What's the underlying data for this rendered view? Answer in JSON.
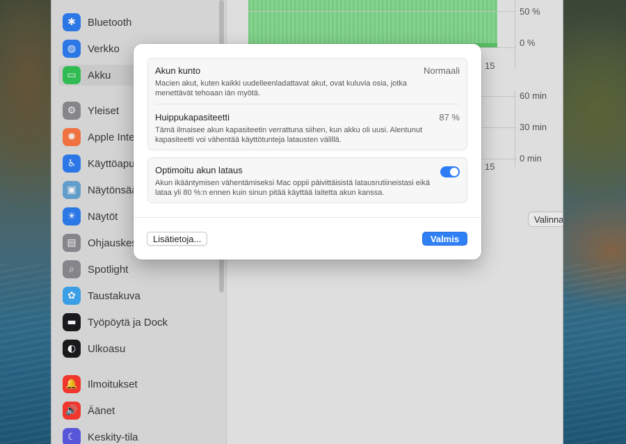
{
  "sidebar": {
    "items": [
      {
        "label": "Bluetooth",
        "icon": "bluetooth-icon",
        "glyph": "✱",
        "color": "#2f7ff5"
      },
      {
        "label": "Verkko",
        "icon": "globe-icon",
        "glyph": "◍",
        "color": "#2f7ff5"
      },
      {
        "label": "Akku",
        "icon": "battery-icon",
        "glyph": "▭",
        "color": "#34c759"
      },
      {
        "label": "Yleiset",
        "icon": "gear-icon",
        "glyph": "⚙",
        "color": "#8e8e93"
      },
      {
        "label": "Apple Inte",
        "icon": "apple-intelligence-icon",
        "glyph": "✺",
        "color": "#ff7a45"
      },
      {
        "label": "Käyttöapu",
        "icon": "accessibility-icon",
        "glyph": "♿",
        "color": "#2f7ff5"
      },
      {
        "label": "Näytönsää",
        "icon": "screensaver-icon",
        "glyph": "▣",
        "color": "#6aa8d8"
      },
      {
        "label": "Näytöt",
        "icon": "displays-icon",
        "glyph": "☀",
        "color": "#2f7ff5"
      },
      {
        "label": "Ohjauskes",
        "icon": "control-center-icon",
        "glyph": "▤",
        "color": "#8e8e93"
      },
      {
        "label": "Spotlight",
        "icon": "spotlight-icon",
        "glyph": "⌕",
        "color": "#8e8e93"
      },
      {
        "label": "Taustakuva",
        "icon": "wallpaper-icon",
        "glyph": "✿",
        "color": "#3fa9f5"
      },
      {
        "label": "Työpöytä ja Dock",
        "icon": "dock-icon",
        "glyph": "▬",
        "color": "#1c1c1e"
      },
      {
        "label": "Ulkoasu",
        "icon": "appearance-icon",
        "glyph": "◐",
        "color": "#1c1c1e"
      },
      {
        "label": "Ilmoitukset",
        "icon": "notifications-icon",
        "glyph": "🔔",
        "color": "#ff3b30"
      },
      {
        "label": "Äänet",
        "icon": "sound-icon",
        "glyph": "🔊",
        "color": "#ff3b30"
      },
      {
        "label": "Keskity-tila",
        "icon": "focus-icon",
        "glyph": "☾",
        "color": "#5e5ce6"
      }
    ]
  },
  "main": {
    "chart_top": {
      "y_labels": [
        "50 %",
        "0 %"
      ],
      "x_label": "15"
    },
    "chart_bottom": {
      "y_labels": [
        "60 min",
        "30 min",
        "0 min"
      ],
      "x_label": "15"
    },
    "options_button": "Valinnat...",
    "help_button": "?"
  },
  "sheet": {
    "health": {
      "title": "Akun kunto",
      "value": "Normaali",
      "desc": "Macien akut, kuten kaikki uudelleenladattavat akut, ovat kuluvia osia, jotka menettävät tehoaan iän myötä."
    },
    "capacity": {
      "title": "Huippukapasiteetti",
      "value": "87 %",
      "desc": "Tämä ilmaisee akun kapasiteetin verrattuna siihen, kun akku oli uusi. Alentunut kapasiteetti voi vähentää käyttötunteja latausten välillä."
    },
    "optimized": {
      "title": "Optimoitu akun lataus",
      "desc": "Akun ikääntymisen vähentämiseksi Mac oppii päivittäisistä latausrutiineistasi eikä lataa yli 80 %:n ennen kuin sinun pitää käyttää laitetta akun kanssa.",
      "enabled": true
    },
    "more_info_button": "Lisätietoja...",
    "done_button": "Valmis"
  }
}
